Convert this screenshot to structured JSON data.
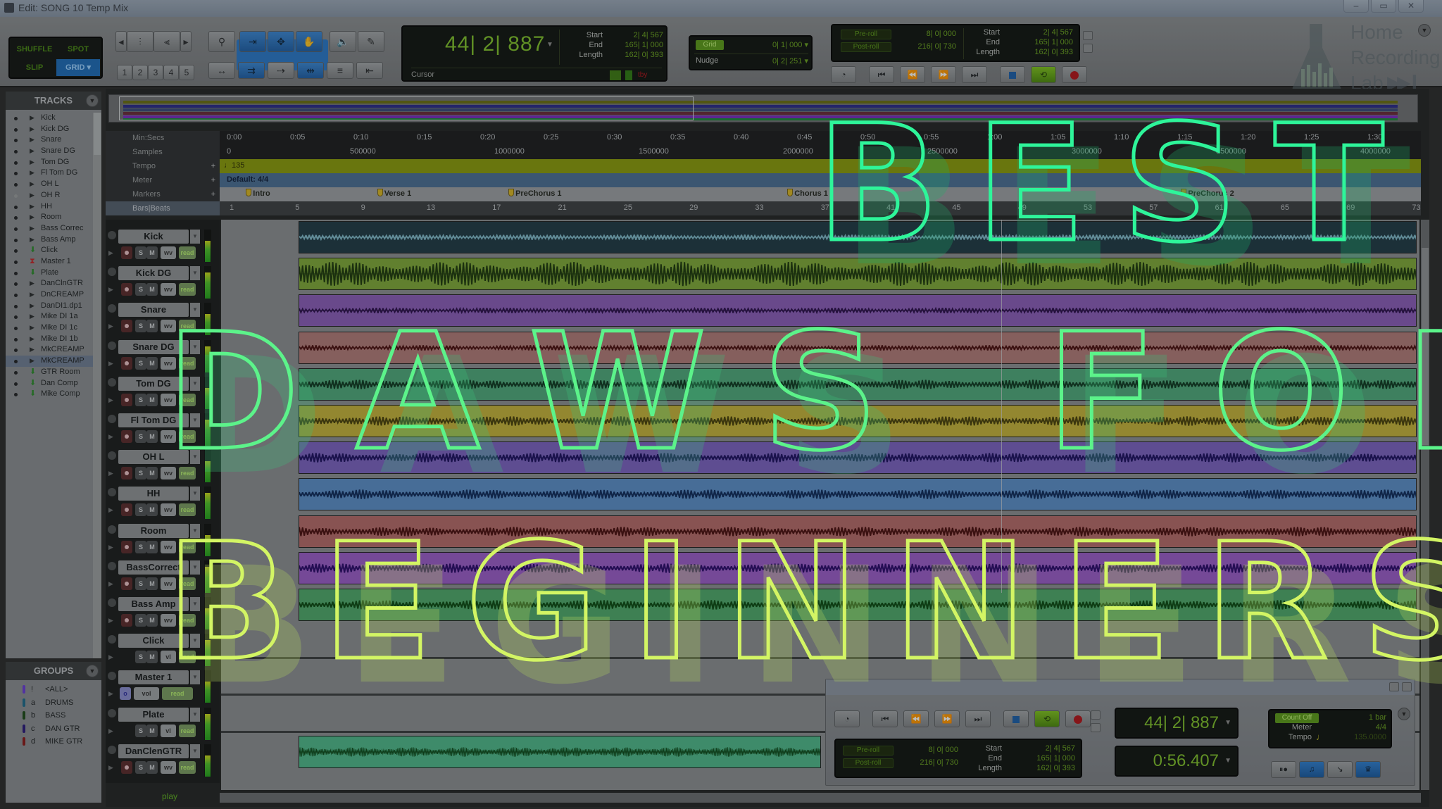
{
  "window": {
    "title": "Edit: SONG 10 Temp Mix",
    "controls": [
      "–",
      "▭",
      "✕"
    ]
  },
  "toolbar": {
    "edit_modes": [
      {
        "label": "SHUFFLE",
        "active": false
      },
      {
        "label": "SPOT",
        "active": false
      },
      {
        "label": "SLIP",
        "active": false
      },
      {
        "label": "GRID ▾",
        "active": true
      }
    ],
    "zoom_presets": [
      "1",
      "2",
      "3",
      "4",
      "5"
    ],
    "tools": [
      "zoomer-tool",
      "trim-tool",
      "selector-tool",
      "grabber-tool",
      "scrubber-tool",
      "pencil-tool"
    ],
    "main_counter": {
      "value": "44| 2| 887",
      "start_label": "Start",
      "start": "2| 4| 567",
      "end_label": "End",
      "end": "165| 1| 000",
      "length_label": "Length",
      "length": "162| 0| 393",
      "cursor_label": "Cursor",
      "indicator_label": "tby"
    },
    "grid": {
      "label": "Grid",
      "value": "0| 1| 000 ▾"
    },
    "nudge": {
      "label": "Nudge",
      "value": "0| 2| 251 ▾"
    },
    "preroll": {
      "label": "Pre-roll",
      "value": "8| 0| 000"
    },
    "postroll": {
      "label": "Post-roll",
      "value": "216| 0| 730"
    },
    "selection": {
      "start_label": "Start",
      "start": "2| 4| 567",
      "end_label": "End",
      "end": "165| 1| 000",
      "length_label": "Length",
      "length": "162| 0| 393"
    },
    "transport": [
      "online",
      "return-to-zero",
      "rewind",
      "fast-forward",
      "go-to-end",
      "stop",
      "play",
      "record"
    ]
  },
  "logo": {
    "line1": "Home",
    "line2": "Recording",
    "line3": "Lab"
  },
  "tracks_panel": {
    "title": "TRACKS",
    "items": [
      {
        "name": "Kick",
        "type": "audio"
      },
      {
        "name": "Kick DG",
        "type": "audio"
      },
      {
        "name": "Snare",
        "type": "audio"
      },
      {
        "name": "Snare DG",
        "type": "audio"
      },
      {
        "name": "Tom DG",
        "type": "audio"
      },
      {
        "name": "Fl Tom DG",
        "type": "audio"
      },
      {
        "name": "OH L",
        "type": "audio"
      },
      {
        "name": "OH R",
        "type": "audio",
        "hidden": true
      },
      {
        "name": "HH",
        "type": "audio"
      },
      {
        "name": "Room",
        "type": "audio"
      },
      {
        "name": "Bass Correc",
        "type": "audio"
      },
      {
        "name": "Bass Amp",
        "type": "audio"
      },
      {
        "name": "Click",
        "type": "aux"
      },
      {
        "name": "Master 1",
        "type": "master"
      },
      {
        "name": "Plate",
        "type": "aux"
      },
      {
        "name": "DanClnGTR",
        "type": "audio"
      },
      {
        "name": "DnCREAMP",
        "type": "audio"
      },
      {
        "name": "DanDI1.dp1",
        "type": "audio"
      },
      {
        "name": "Mike DI 1a",
        "type": "audio"
      },
      {
        "name": "Mike DI 1c",
        "type": "audio"
      },
      {
        "name": "Mike DI 1b",
        "type": "audio"
      },
      {
        "name": "MkCREAMP",
        "type": "audio"
      },
      {
        "name": "MkCREAMP",
        "type": "audio",
        "selected": true
      },
      {
        "name": "GTR Room",
        "type": "aux"
      },
      {
        "name": "Dan Comp",
        "type": "aux"
      },
      {
        "name": "Mike Comp",
        "type": "aux"
      }
    ]
  },
  "groups_panel": {
    "title": "GROUPS",
    "items": [
      {
        "id": "!",
        "name": "<ALL>",
        "color": "#6a3cd6"
      },
      {
        "id": "a",
        "name": "DRUMS",
        "color": "#1e6a8a"
      },
      {
        "id": "b",
        "name": "BASS",
        "color": "#1e4a1a"
      },
      {
        "id": "c",
        "name": "DAN GTR",
        "color": "#2a1a7a"
      },
      {
        "id": "d",
        "name": "MIKE GTR",
        "color": "#8a1a1a"
      }
    ]
  },
  "rulers": {
    "labels": [
      "Min:Secs",
      "Samples",
      "Tempo",
      "Meter",
      "Markers",
      "Bars|Beats"
    ],
    "minsecs": [
      "0:00",
      "0:05",
      "0:10",
      "0:15",
      "0:20",
      "0:25",
      "0:30",
      "0:35",
      "0:40",
      "0:45",
      "0:50",
      "0:55",
      "1:00",
      "1:05",
      "1:10",
      "1:15",
      "1:20",
      "1:25",
      "1:30"
    ],
    "samples": [
      "0",
      "500000",
      "1000000",
      "1500000",
      "2000000",
      "2500000",
      "3000000",
      "3500000",
      "4000000"
    ],
    "tempo": "135",
    "meter": "Default: 4/4",
    "markers": [
      {
        "label": "Intro",
        "bar": 2
      },
      {
        "label": "Verse 1",
        "bar": 10
      },
      {
        "label": "PreChorus 1",
        "bar": 18
      },
      {
        "label": "Chorus 1",
        "bar": 35
      },
      {
        "label": "PreChorus 2",
        "bar": 59
      }
    ],
    "bars": [
      "1",
      "5",
      "9",
      "13",
      "17",
      "21",
      "25",
      "29",
      "33",
      "37",
      "41",
      "45",
      "49",
      "53",
      "57",
      "61",
      "65",
      "69",
      "73"
    ]
  },
  "edit_tracks": [
    {
      "name": "Kick",
      "color": "#1f3a44",
      "wave": "#7fb8c8",
      "kind": "audio"
    },
    {
      "name": "Kick DG",
      "color": "#7fa838",
      "wave": "#1e3a0c",
      "kind": "audio"
    },
    {
      "name": "Snare",
      "color": "#8a5cb8",
      "wave": "#2a0f4a",
      "kind": "audio"
    },
    {
      "name": "Snare DG",
      "color": "#b07a78",
      "wave": "#4a0e0e",
      "kind": "audio"
    },
    {
      "name": "Tom DG",
      "color": "#4ea87a",
      "wave": "#0e3a22",
      "kind": "audio"
    },
    {
      "name": "Fl Tom DG",
      "color": "#c4b23a",
      "wave": "#4a420a",
      "kind": "audio"
    },
    {
      "name": "OH L",
      "color": "#7a62c0",
      "wave": "#1c1060",
      "kind": "audio"
    },
    {
      "name": "HH",
      "color": "#5a8ec8",
      "wave": "#0e2a5a",
      "kind": "audio"
    },
    {
      "name": "Room",
      "color": "#b46a68",
      "wave": "#4a0e0e",
      "kind": "audio"
    },
    {
      "name": "BassCorrect",
      "color": "#9a5cc8",
      "wave": "#2a0a6a",
      "kind": "audio"
    },
    {
      "name": "Bass Amp",
      "color": "#4ea86a",
      "wave": "#0c4a12",
      "kind": "audio"
    },
    {
      "name": "Click",
      "kind": "aux"
    },
    {
      "name": "Master 1",
      "kind": "master",
      "vol": "vol",
      "mode": "read"
    },
    {
      "name": "Plate",
      "kind": "aux"
    },
    {
      "name": "DanClenGTR",
      "color": "#4eb88a",
      "wave": "#0c4a1a",
      "kind": "audio"
    }
  ],
  "track_buttons": {
    "solo": "S",
    "mute": "M",
    "view": "wv",
    "auto": "read",
    "aux_view": "vl"
  },
  "status": {
    "play_label": "play"
  },
  "float_transport": {
    "counter_main": "44| 2| 887",
    "counter_sub": "0:56.407",
    "preroll": {
      "label": "Pre-roll",
      "value": "8| 0| 000"
    },
    "postroll": {
      "label": "Post-roll",
      "value": "216| 0| 730"
    },
    "start_label": "Start",
    "start": "2| 4| 567",
    "end_label": "End",
    "end": "165| 1| 000",
    "length_label": "Length",
    "length": "162| 0| 393",
    "count_off": "Count Off",
    "count_off_value": "1 bar",
    "meter_label": "Meter",
    "meter_value": "4/4",
    "tempo_label": "Tempo",
    "tempo_value": "135.0000"
  },
  "headline": {
    "line1": "BEST",
    "line2": "DAWS FOR",
    "line3": "BEGINNERS",
    "colors": {
      "line1": "#2ef59a",
      "line2": "#5cf38a",
      "line3": "#d3f564"
    }
  }
}
